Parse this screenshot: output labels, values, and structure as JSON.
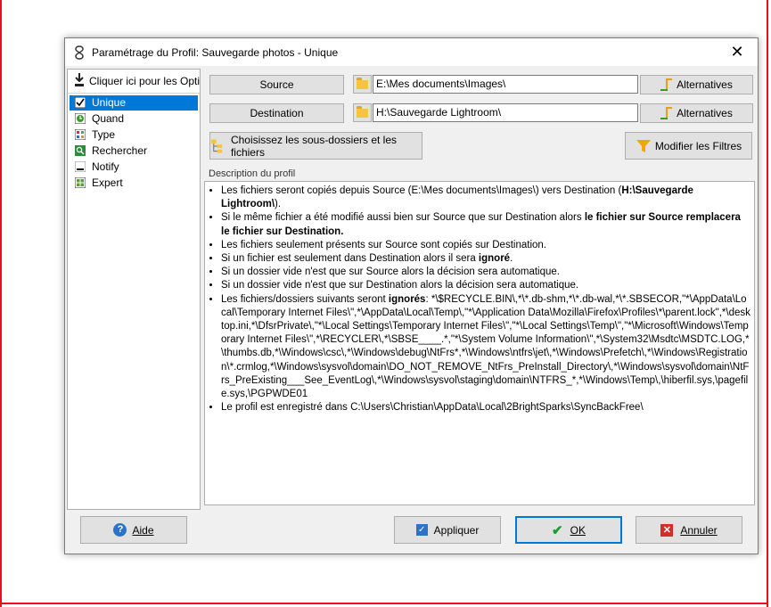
{
  "window": {
    "title": "Paramétrage du Profil: Sauvegarde photos - Unique"
  },
  "left_panel": {
    "header": "Cliquer ici pour les Opti",
    "items": [
      {
        "label": "Unique",
        "selected": true
      },
      {
        "label": "Quand",
        "selected": false
      },
      {
        "label": "Type",
        "selected": false
      },
      {
        "label": "Rechercher",
        "selected": false
      },
      {
        "label": "Notify",
        "selected": false
      },
      {
        "label": "Expert",
        "selected": false
      }
    ]
  },
  "source": {
    "button": "Source",
    "path": "E:\\Mes documents\\Images\\",
    "alternatives": "Alternatives"
  },
  "destination": {
    "button": "Destination",
    "path": "H:\\Sauvegarde Lightroom\\",
    "alternatives": "Alternatives"
  },
  "subfolders_button": "Choisissez les sous-dossiers et les fichiers",
  "filters_button": "Modifier les Filtres",
  "description_label": "Description du profil",
  "description": [
    {
      "text": "Les fichiers seront copiés depuis Source (E:\\Mes documents\\Images\\) vers Destination (",
      "bold": "H:\\Sauvegarde Lightroom\\",
      "tail": ")."
    },
    {
      "text": "Si le même fichier a été modifié aussi bien sur Source que sur Destination alors ",
      "bold": "le fichier sur Source remplacera le fichier sur Destination.",
      "tail": ""
    },
    {
      "text": "Les fichiers seulement présents sur Source sont copiés sur Destination.",
      "bold": "",
      "tail": ""
    },
    {
      "text": "Si un fichier est seulement dans Destination alors il sera ",
      "bold": "ignoré",
      "tail": "."
    },
    {
      "text": "Si un dossier vide n'est que sur Source alors la décision sera automatique.",
      "bold": "",
      "tail": ""
    },
    {
      "text": "Si un dossier vide n'est que sur Destination alors la décision sera automatique.",
      "bold": "",
      "tail": ""
    },
    {
      "text": "Les fichiers/dossiers suivants seront ",
      "bold": "ignorés",
      "tail": ": *\\$RECYCLE.BIN\\,*\\*.db-shm,*\\*.db-wal,*\\*.SBSECOR,\"*\\AppData\\Local\\Temporary Internet Files\\\",*\\AppData\\Local\\Temp\\,\"*\\Application Data\\Mozilla\\Firefox\\Profiles\\*\\parent.lock\",*\\desktop.ini,*\\DfsrPrivate\\,\"*\\Local Settings\\Temporary Internet Files\\\",\"*\\Local Settings\\Temp\\\",\"*\\Microsoft\\Windows\\Temporary Internet Files\\\",*\\RECYCLER\\,*\\SBSE____.*,\"*\\System Volume Information\\\",*\\System32\\Msdtc\\MSDTC.LOG,*\\thumbs.db,*\\Windows\\csc\\,*\\Windows\\debug\\NtFrs*,*\\Windows\\ntfrs\\jet\\,*\\Windows\\Prefetch\\,*\\Windows\\Registration\\*.crmlog,*\\Windows\\sysvol\\domain\\DO_NOT_REMOVE_NtFrs_PreInstall_Directory\\,*\\Windows\\sysvol\\domain\\NtFrs_PreExisting___See_EventLog\\,*\\Windows\\sysvol\\staging\\domain\\NTFRS_*,*\\Windows\\Temp\\,\\hiberfil.sys,\\pagefile.sys,\\PGPWDE01"
    },
    {
      "text": "Le profil est enregistré dans C:\\Users\\Christian\\AppData\\Local\\2BrightSparks\\SyncBackFree\\",
      "bold": "",
      "tail": ""
    }
  ],
  "footer": {
    "help": "Aide",
    "apply": "Appliquer",
    "ok": "OK",
    "cancel": "Annuler"
  },
  "icons": [
    "app-icon",
    "close-icon",
    "download-arrow-icon",
    "check-icon",
    "clock-icon",
    "type-icon",
    "search-icon",
    "notify-icon",
    "expert-icon",
    "folder-icon",
    "alternatives-icon",
    "subfolders-icon",
    "funnel-icon",
    "help-icon",
    "apply-icon",
    "ok-check-icon",
    "cancel-x-icon"
  ],
  "colors": {
    "accent": "#0078d7",
    "frame_red": "#e81123",
    "dialog_bg": "#f0f0f0"
  }
}
